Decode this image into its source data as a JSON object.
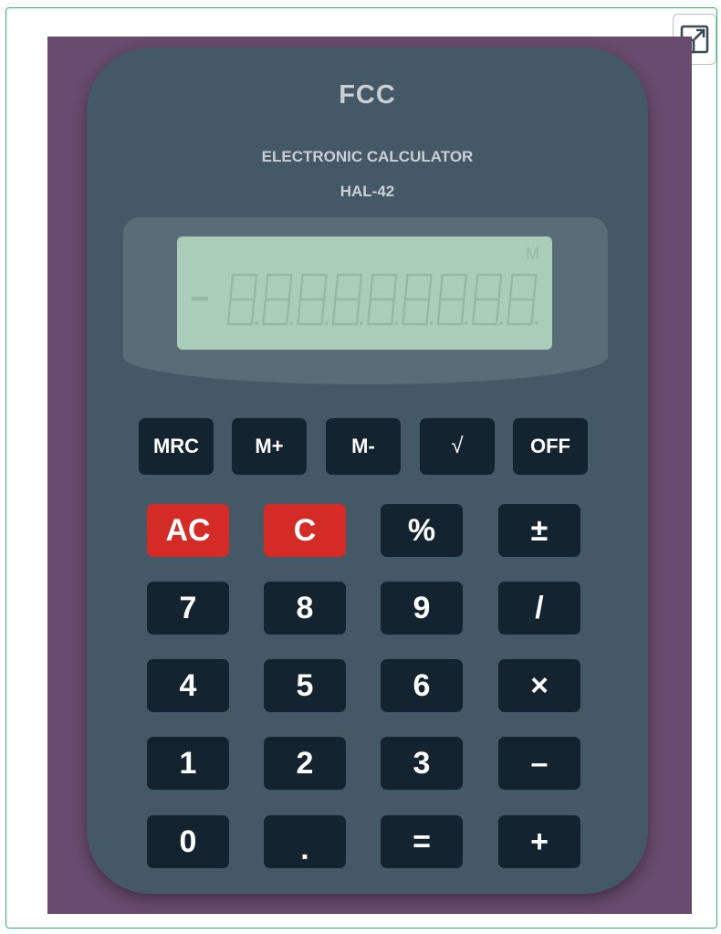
{
  "expand_button": {
    "icon": "expand-icon"
  },
  "calculator": {
    "brand": "FCC",
    "subtitle": "ELECTRONIC CALCULATOR",
    "model": "HAL-42",
    "display": {
      "memory_indicator": "M",
      "sign": "−",
      "digit_count": 9,
      "text": "8.8.8.8.8.8.8.8.8."
    },
    "function_keys": [
      "MRC",
      "M+",
      "M-",
      "√",
      "OFF"
    ],
    "keypad": {
      "row1": [
        "AC",
        "C",
        "%",
        "±"
      ],
      "row2": [
        "7",
        "8",
        "9",
        "/"
      ],
      "row3": [
        "4",
        "5",
        "6",
        "×"
      ],
      "row4": [
        "1",
        "2",
        "3",
        "–"
      ],
      "row5": [
        "0",
        ".",
        "=",
        "+"
      ]
    }
  },
  "colors": {
    "page_border": "#36b873",
    "stage_background": "#684b6e",
    "calculator_body": "#455866",
    "display_housing": "#5b6c79",
    "lcd_background": "#a9cdb8",
    "lcd_segment": "#93b7a3",
    "key_dark": "#132330",
    "key_red": "#d52b27",
    "label_text": "#c9cfd5"
  }
}
